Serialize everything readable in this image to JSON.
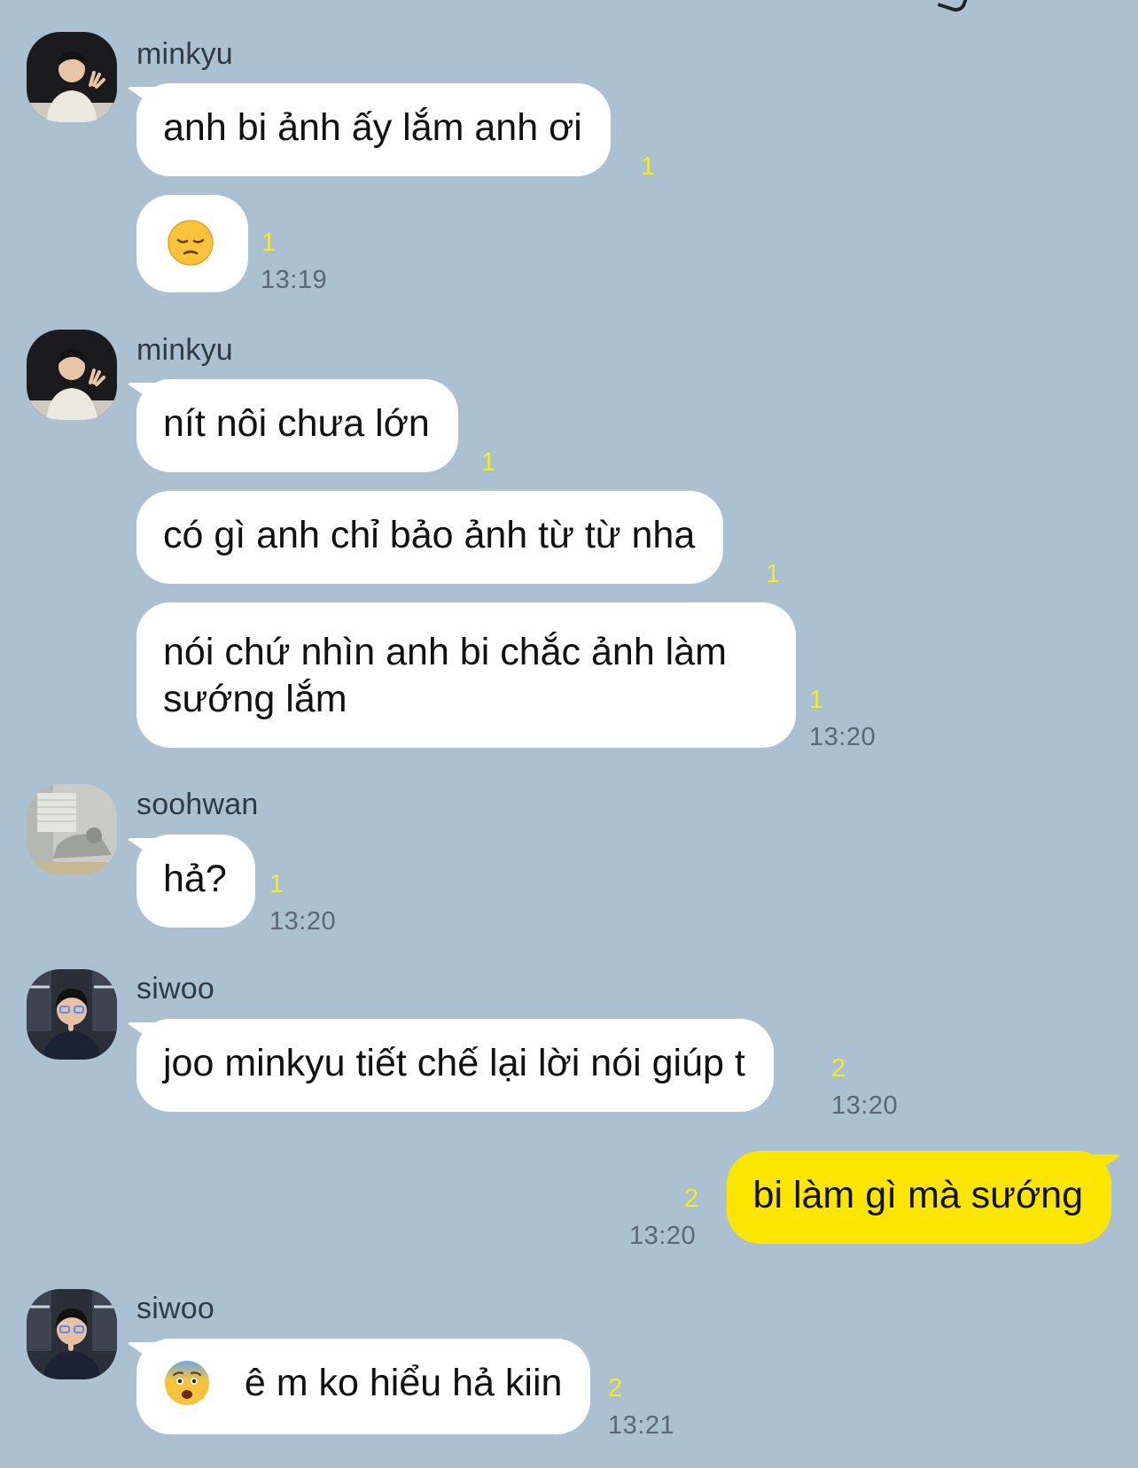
{
  "chat": {
    "messages": [
      {
        "sender": "minkyu",
        "bubbles": [
          {
            "text": "anh bi ảnh ấy lắm anh ơi",
            "unread": "1"
          },
          {
            "emoji": "pensive-face",
            "text": "",
            "unread": "1",
            "time": "13:19"
          }
        ]
      },
      {
        "sender": "minkyu",
        "bubbles": [
          {
            "text": "nít nôi chưa lớn",
            "unread": "1"
          },
          {
            "text": "có gì anh chỉ bảo ảnh từ từ nha",
            "unread": "1"
          },
          {
            "text": "nói chứ nhìn anh bi chắc ảnh làm sướng lắm",
            "unread": "1",
            "time": "13:20"
          }
        ]
      },
      {
        "sender": "soohwan",
        "bubbles": [
          {
            "text": "hả?",
            "unread": "1",
            "time": "13:20"
          }
        ]
      },
      {
        "sender": "siwoo",
        "bubbles": [
          {
            "text": "joo minkyu tiết chế lại lời nói giúp t",
            "unread": "2",
            "time": "13:20"
          }
        ]
      },
      {
        "sender": "me",
        "bubbles": [
          {
            "text": "bi làm gì mà sướng",
            "unread": "2",
            "time": "13:20"
          }
        ]
      },
      {
        "sender": "siwoo",
        "bubbles": [
          {
            "emoji": "fearful-face",
            "text": "ê m ko hiểu hả kiin",
            "unread": "2",
            "time": "13:21"
          }
        ]
      }
    ]
  },
  "colors": {
    "background": "#abc1d1",
    "incoming_bubble": "#ffffff",
    "outgoing_bubble": "#fae600",
    "unread_count": "#f7eb2b",
    "timestamp": "#5b6774"
  }
}
